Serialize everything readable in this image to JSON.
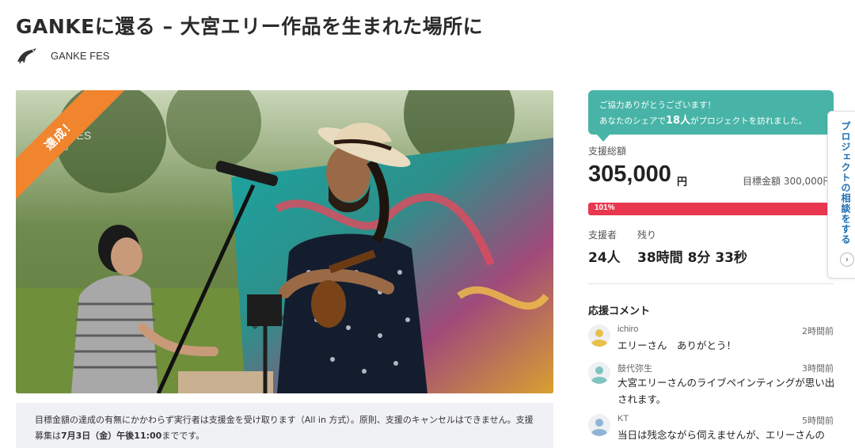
{
  "project": {
    "title": "GANKEに還る – 大宮エリー作品を生まれた場所に",
    "owner_name": "GANKE FES",
    "owner_logo_icon": "bird-logo-icon",
    "achieved_badge": "達成！",
    "hero_photo_text": [
      "FES",
      "2015"
    ]
  },
  "notice": {
    "text_before": "目標金額の達成の有無にかかわらず実行者は支援金を受け取ります（All in 方式）。原則、支援のキャンセルはできません。支援募集は",
    "deadline": "7月3日（金）午後11:00",
    "text_after": "までです。"
  },
  "thanks": {
    "line1": "ご協力ありがとうございます！",
    "line2_before": "あなたのシェアで",
    "count": "18人",
    "line2_after": "がプロジェクトを訪れました。"
  },
  "stats": {
    "total_label": "支援総額",
    "amount": "305,000",
    "amount_unit": "円",
    "goal": "目標金額 300,000円",
    "progress_label": "101%",
    "progress_fraction": 1.01,
    "supporters_label": "支援者",
    "supporters": "24人",
    "remaining_label": "残り",
    "remaining": "38時間 8分 33秒"
  },
  "comments": {
    "title": "応援コメント",
    "items": [
      {
        "name": "ichiro",
        "time": "2時間前",
        "text": "エリーさん　ありがとう！",
        "color": "#e8c04a"
      },
      {
        "name": "鼓代弥生",
        "time": "3時間前",
        "text": "大宮エリーさんのライブペインティングが思い出されます。",
        "color": "#7fc3c0"
      },
      {
        "name": "KT",
        "time": "5時間前",
        "text": "当日は残念ながら伺えませんが、エリーさんの",
        "color": "#8fb4d6"
      }
    ]
  },
  "consult": {
    "label": "プロジェクトの相談をする",
    "arrow": "›"
  },
  "colors": {
    "accent_green": "#48b4a8",
    "progress_red": "#e8374f",
    "ribbon_orange": "#f0852d",
    "link_blue": "#1d6fb3"
  }
}
